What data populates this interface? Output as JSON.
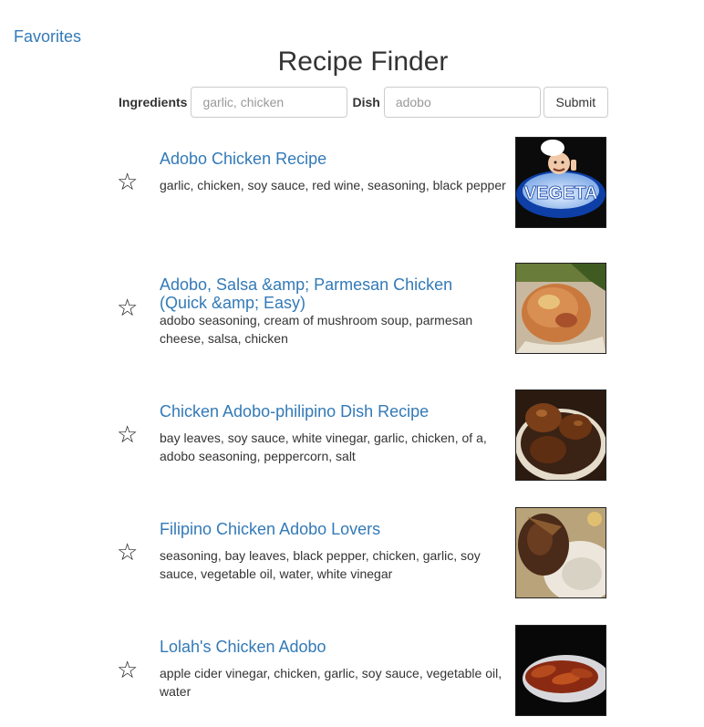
{
  "nav": {
    "favorites": "Favorites"
  },
  "page": {
    "title": "Recipe Finder"
  },
  "search": {
    "ingredients_label": "Ingredients",
    "ingredients_placeholder": "garlic, chicken",
    "dish_label": "Dish",
    "dish_placeholder": "adobo",
    "submit_label": "Submit"
  },
  "results": [
    {
      "title": "Adobo Chicken Recipe",
      "ingredients": "garlic, chicken, soy sauce, red wine, seasoning, black pepper",
      "favorite_icon": "☆",
      "thumb_text": "VEGETA"
    },
    {
      "title": "Adobo, Salsa &amp; Parmesan Chicken (Quick &amp; Easy)",
      "ingredients": "adobo seasoning, cream of mushroom soup, parmesan cheese, salsa, chicken",
      "favorite_icon": "☆"
    },
    {
      "title": "Chicken Adobo-philipino Dish Recipe",
      "ingredients": "bay leaves, soy sauce, white vinegar, garlic, chicken, of a, adobo seasoning, peppercorn, salt",
      "favorite_icon": "☆"
    },
    {
      "title": "Filipino Chicken Adobo Lovers",
      "ingredients": "seasoning, bay leaves, black pepper, chicken, garlic, soy sauce, vegetable oil, water, white vinegar",
      "favorite_icon": "☆"
    },
    {
      "title": "Lolah's Chicken Adobo",
      "ingredients": "apple cider vinegar, chicken, garlic, soy sauce, vegetable oil, water",
      "favorite_icon": "☆"
    }
  ],
  "colors": {
    "link": "#337ab7",
    "text": "#333333",
    "input_border": "#cccccc"
  }
}
